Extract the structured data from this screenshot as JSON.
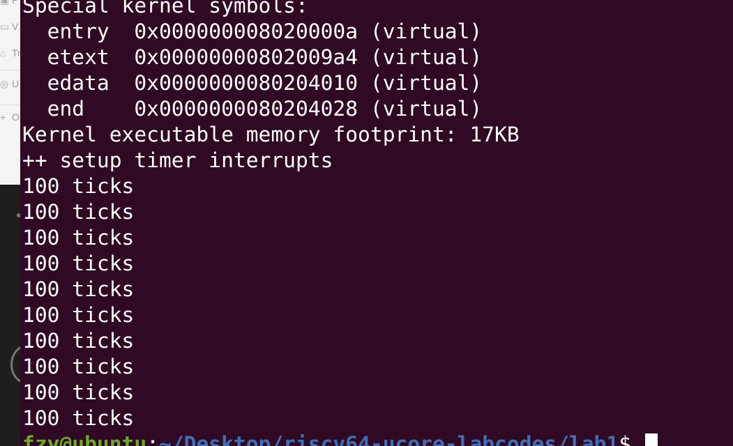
{
  "side_menu": {
    "items": [
      {
        "icon": "image-icon",
        "label": "P"
      },
      {
        "icon": "video-icon",
        "label": "V"
      },
      {
        "icon": "trash-icon",
        "label": "Tr"
      },
      {
        "icon": "eye-icon",
        "label": "U"
      },
      {
        "icon": "plus-icon",
        "label": "O"
      }
    ]
  },
  "terminal": {
    "lines": [
      "Special kernel symbols:",
      "  entry  0x000000008020000a (virtual)",
      "  etext  0x00000000802009a4 (virtual)",
      "  edata  0x0000000080204010 (virtual)",
      "  end    0x0000000080204028 (virtual)",
      "Kernel executable memory footprint: 17KB",
      "++ setup timer interrupts",
      "100 ticks",
      "100 ticks",
      "100 ticks",
      "100 ticks",
      "100 ticks",
      "100 ticks",
      "100 ticks",
      "100 ticks",
      "100 ticks",
      "100 ticks"
    ],
    "prompt": {
      "user_host": "fzy@ubuntu",
      "sep": ":",
      "path": "~/Desktop/riscv64-ucore-labcodes/lab1",
      "symbol": "$ "
    },
    "colors": {
      "background": "#300a24",
      "user": "#6fa82a",
      "path": "#3f6fb5"
    }
  }
}
